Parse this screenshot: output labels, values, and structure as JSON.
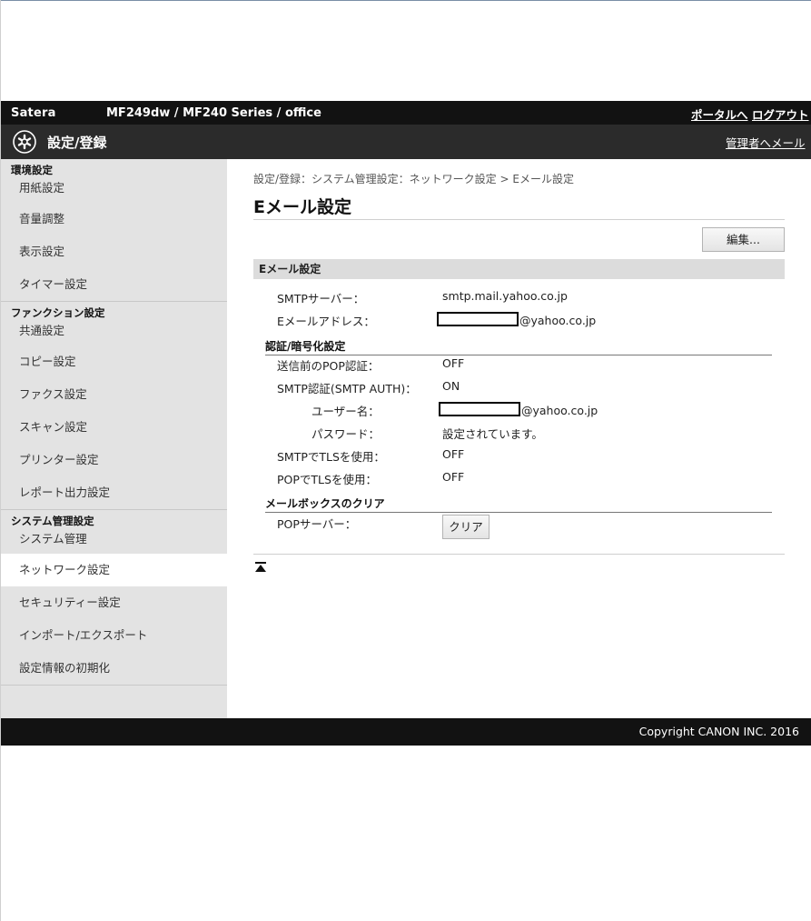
{
  "header": {
    "brand": "Satera",
    "model": "MF249dw / MF240 Series / office",
    "portal_link": "ポータルへ",
    "logout_link": "ログアウト"
  },
  "subheader": {
    "logo_icon": "settings-register-icon",
    "title": "設定/登録",
    "admin_mail_link": "管理者へメール"
  },
  "sidebar": {
    "groups": [
      {
        "heading": "環境設定",
        "items": [
          "用紙設定",
          "音量調整",
          "表示設定",
          "タイマー設定"
        ]
      },
      {
        "heading": "ファンクション設定",
        "items": [
          "共通設定",
          "コピー設定",
          "ファクス設定",
          "スキャン設定",
          "プリンター設定",
          "レポート出力設定"
        ]
      },
      {
        "heading": "システム管理設定",
        "items": [
          "システム管理",
          "ネットワーク設定",
          "セキュリティー設定",
          "インポート/エクスポート",
          "設定情報の初期化"
        ]
      }
    ],
    "active_item": "ネットワーク設定"
  },
  "main": {
    "breadcrumb": "設定/登録：システム管理設定：ネットワーク設定 > Eメール設定",
    "page_title": "Eメール設定",
    "edit_button": "編集...",
    "section_title": "Eメール設定",
    "smtp_server_label": "SMTPサーバー：",
    "smtp_server_value": "smtp.mail.yahoo.co.jp",
    "email_label": "Eメールアドレス：",
    "email_domain": "@yahoo.co.jp",
    "auth_section": "認証/暗号化設定",
    "pop_before_label": "送信前のPOP認証：",
    "pop_before_value": "OFF",
    "smtp_auth_label": "SMTP認証(SMTP AUTH)：",
    "smtp_auth_value": "ON",
    "username_label": "ユーザー名：",
    "username_domain": "@yahoo.co.jp",
    "password_label": "パスワード：",
    "password_value": "設定されています。",
    "smtp_tls_label": "SMTPでTLSを使用：",
    "smtp_tls_value": "OFF",
    "pop_tls_label": "POPでTLSを使用：",
    "pop_tls_value": "OFF",
    "mailbox_section": "メールボックスのクリア",
    "pop_server_label": "POPサーバー：",
    "clear_button": "クリア"
  },
  "footer": {
    "copyright": "Copyright CANON INC. 2016"
  }
}
